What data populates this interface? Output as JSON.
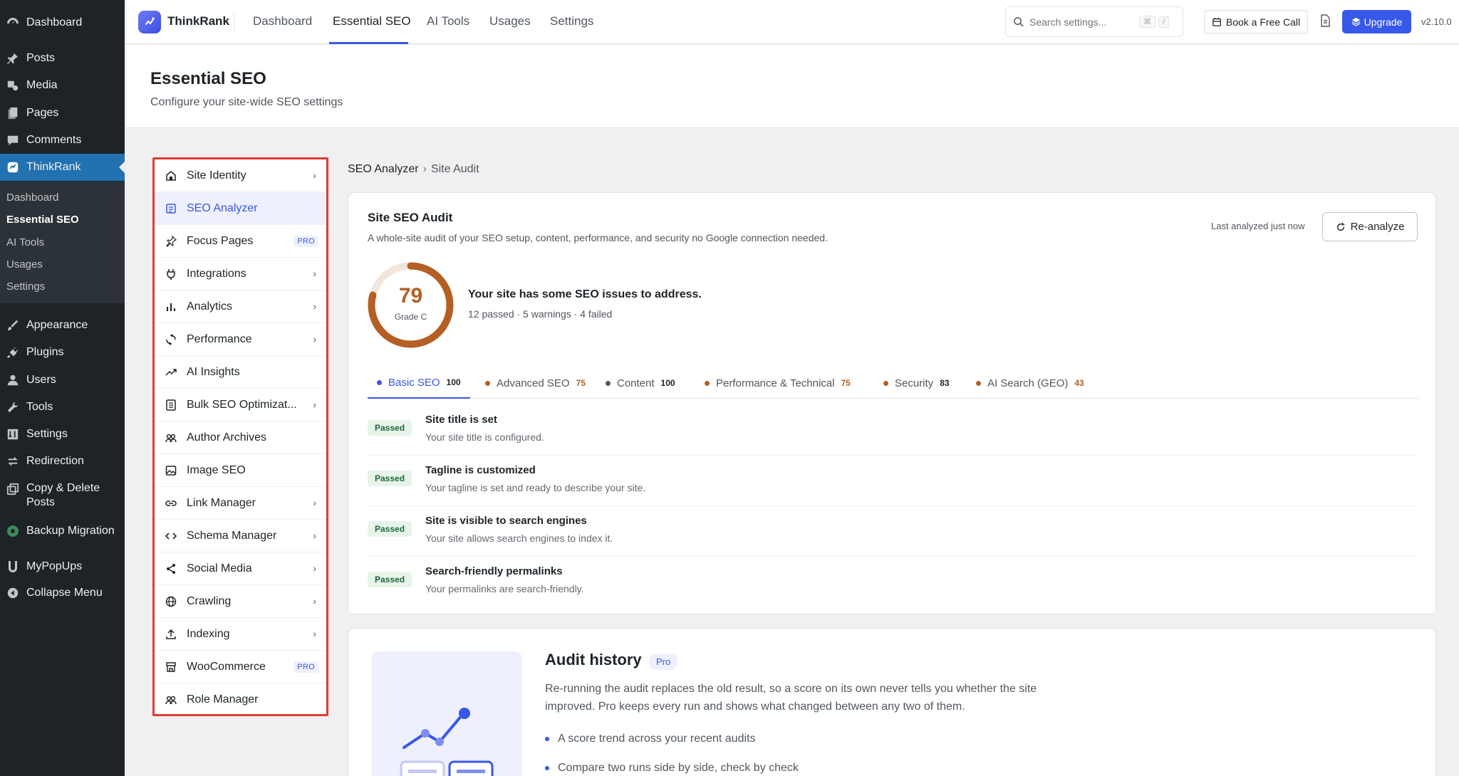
{
  "wp_menu": {
    "items": [
      {
        "label": "Dashboard",
        "icon": "dashboard-icon"
      },
      {
        "label": "Posts",
        "icon": "pin-icon"
      },
      {
        "label": "Media",
        "icon": "media-icon"
      },
      {
        "label": "Pages",
        "icon": "pages-icon"
      },
      {
        "label": "Comments",
        "icon": "comment-icon"
      },
      {
        "label": "ThinkRank",
        "icon": "thinkrank-icon"
      },
      {
        "label": "Appearance",
        "icon": "brush-icon"
      },
      {
        "label": "Plugins",
        "icon": "plugin-icon"
      },
      {
        "label": "Users",
        "icon": "user-icon"
      },
      {
        "label": "Tools",
        "icon": "wrench-icon"
      },
      {
        "label": "Settings",
        "icon": "settings-icon"
      },
      {
        "label": "Redirection",
        "icon": "redirect-icon"
      },
      {
        "label": "Copy & Delete",
        "label2": "Posts",
        "icon": "copy-icon"
      },
      {
        "label": "Backup Migration",
        "icon": "backup-icon"
      },
      {
        "label": "MyPopUps",
        "icon": "popup-icon"
      },
      {
        "label": "Collapse Menu",
        "icon": "collapse-icon"
      }
    ],
    "submenu": [
      "Dashboard",
      "Essential SEO",
      "AI Tools",
      "Usages",
      "Settings"
    ]
  },
  "topbar": {
    "brand": "ThinkRank",
    "nav": [
      "Dashboard",
      "Essential SEO",
      "AI Tools",
      "Usages",
      "Settings"
    ],
    "search_placeholder": "Search settings...",
    "kbd1": "⌘",
    "kbd2": "/",
    "book_call": "Book a Free Call",
    "upgrade": "Upgrade",
    "version": "v2.10.0"
  },
  "page": {
    "title": "Essential SEO",
    "subtitle": "Configure your site-wide SEO settings"
  },
  "settings_nav": [
    {
      "label": "Site Identity",
      "icon": "home-icon",
      "chevron": true
    },
    {
      "label": "SEO Analyzer",
      "icon": "analyzer-icon",
      "active": true
    },
    {
      "label": "Focus Pages",
      "icon": "pin-icon",
      "pro": true
    },
    {
      "label": "Integrations",
      "icon": "plug-icon",
      "chevron": true
    },
    {
      "label": "Analytics",
      "icon": "bar-chart-icon",
      "chevron": true
    },
    {
      "label": "Performance",
      "icon": "performance-icon",
      "chevron": true
    },
    {
      "label": "AI Insights",
      "icon": "trend-icon"
    },
    {
      "label": "Bulk SEO Optimizat...",
      "icon": "bulk-icon",
      "chevron": true
    },
    {
      "label": "Author Archives",
      "icon": "users-icon"
    },
    {
      "label": "Image SEO",
      "icon": "image-icon"
    },
    {
      "label": "Link Manager",
      "icon": "link-icon",
      "chevron": true
    },
    {
      "label": "Schema Manager",
      "icon": "code-icon",
      "chevron": true
    },
    {
      "label": "Social Media",
      "icon": "share-icon",
      "chevron": true
    },
    {
      "label": "Crawling",
      "icon": "globe-icon",
      "chevron": true
    },
    {
      "label": "Indexing",
      "icon": "upload-icon",
      "chevron": true
    },
    {
      "label": "WooCommerce",
      "icon": "store-icon",
      "pro": true
    },
    {
      "label": "Role Manager",
      "icon": "users-icon"
    }
  ],
  "pro_label": "PRO",
  "breadcrumb": {
    "parent": "SEO Analyzer",
    "sep": "›",
    "current": "Site Audit"
  },
  "audit": {
    "title": "Site SEO Audit",
    "description": "A whole-site audit of your SEO setup, content, performance, and security no Google connection needed.",
    "last_analyzed": "Last analyzed just now",
    "reanalyze": "Re-analyze",
    "score": 79,
    "score_label": "79",
    "grade": "Grade C",
    "summary_title": "Your site has some SEO issues to address.",
    "summary_stats": "12 passed · 5 warnings · 4 failed",
    "tabs": [
      {
        "label": "Basic SEO",
        "score": "100",
        "status": "good",
        "active": true
      },
      {
        "label": "Advanced SEO",
        "score": "75",
        "status": "warn"
      },
      {
        "label": "Content",
        "score": "100",
        "status": "good"
      },
      {
        "label": "Performance & Technical",
        "score": "75",
        "status": "warn"
      },
      {
        "label": "Security",
        "score": "83",
        "status": "warn"
      },
      {
        "label": "AI Search (GEO)",
        "score": "43",
        "status": "warn"
      }
    ],
    "checks": [
      {
        "badge": "Passed",
        "title": "Site title is set",
        "desc": "Your site title is configured."
      },
      {
        "badge": "Passed",
        "title": "Tagline is customized",
        "desc": "Your tagline is set and ready to describe your site."
      },
      {
        "badge": "Passed",
        "title": "Site is visible to search engines",
        "desc": "Your site allows search engines to index it."
      },
      {
        "badge": "Passed",
        "title": "Search-friendly permalinks",
        "desc": "Your permalinks are search-friendly."
      }
    ]
  },
  "history": {
    "title": "Audit history",
    "pro": "Pro",
    "description": "Re-running the audit replaces the old result, so a score on its own never tells you whether the site improved. Pro keeps every run and shows what changed between any two of them.",
    "bullets": [
      "A score trend across your recent audits",
      "Compare two runs side by side, check by check"
    ]
  },
  "colors": {
    "accent": "#3858e9",
    "warn": "#b45f23",
    "passed_bg": "#e6f4ea",
    "wp_active": "#2271b1"
  }
}
